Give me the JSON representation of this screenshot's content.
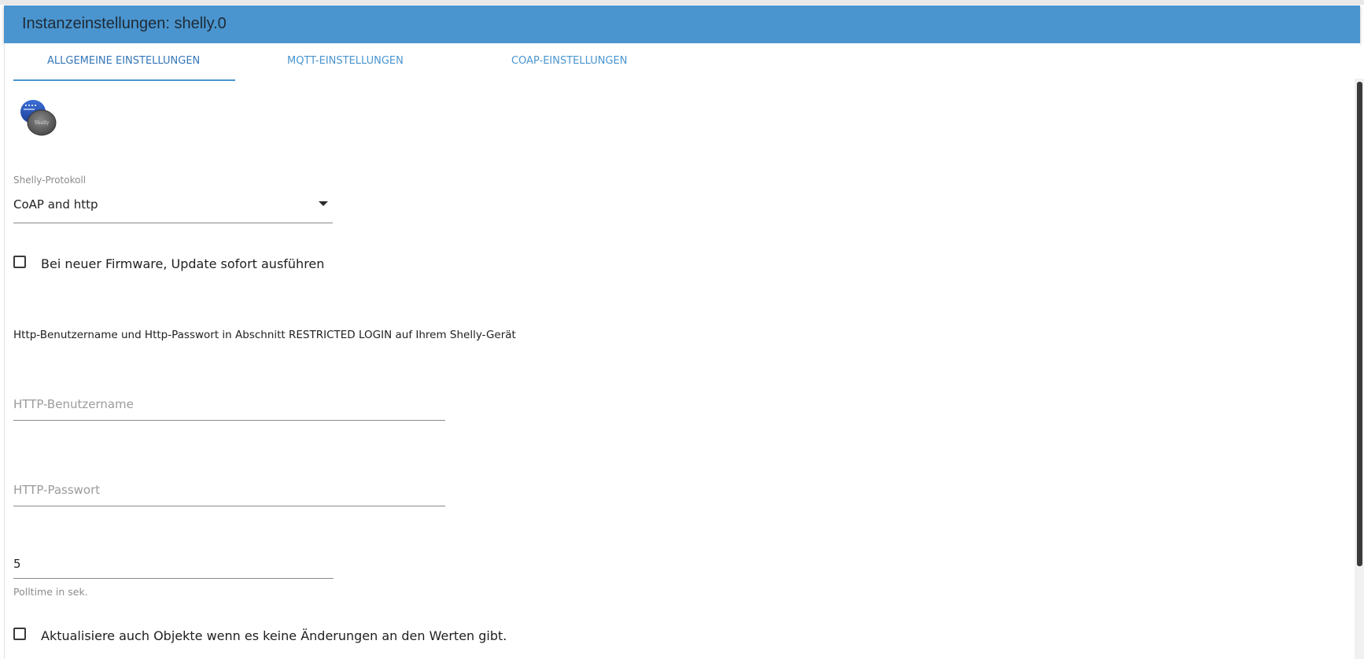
{
  "header": {
    "title": "Instanzeinstellungen: shelly.0",
    "background_color": "#4a95cf"
  },
  "tabs": [
    {
      "label": "ALLGEMEINE EINSTELLUNGEN",
      "active": true
    },
    {
      "label": "MQTT-EINSTELLUNGEN",
      "active": false
    },
    {
      "label": "COAP-EINSTELLUNGEN",
      "active": false
    }
  ],
  "logo": {
    "icon": "shelly-logo-icon",
    "text": "Shelly"
  },
  "protocol": {
    "label": "Shelly-Protokoll",
    "value": "CoAP and http"
  },
  "autoupdate": {
    "label": "Bei neuer Firmware, Update sofort ausführen",
    "checked": false
  },
  "http_info": "Http-Benutzername und Http-Passwort in Abschnitt RESTRICTED LOGIN auf Ihrem Shelly-Gerät",
  "http_username": {
    "placeholder": "HTTP-Benutzername",
    "value": ""
  },
  "http_password": {
    "placeholder": "HTTP-Passwort",
    "value": ""
  },
  "polltime": {
    "value": "5",
    "helper": "Polltime in sek."
  },
  "update_unchanged": {
    "label": "Aktualisiere auch Objekte wenn es keine Änderungen an den Werten gibt.",
    "checked": false
  }
}
